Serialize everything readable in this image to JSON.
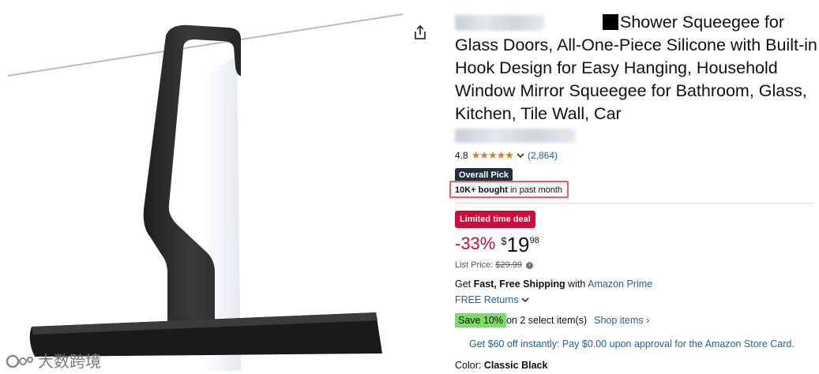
{
  "product": {
    "title": "Shower Squeegee for Glass Doors, All-One-Piece Silicone with Built-in Hook Design for Easy Hanging, Household Window Mirror Squeegee for Bathroom, Glass, Kitchen, Tile Wall, Car",
    "rating_value": "4.8",
    "stars": "★★★★★",
    "rating_count": "(2,864)",
    "badge": "Overall Pick",
    "bought_bold": "10K+ bought",
    "bought_rest": " in past month"
  },
  "pricing": {
    "deal_badge": "Limited time deal",
    "discount": "-33%",
    "currency": "$",
    "whole": "19",
    "fraction": "98",
    "list_label": "List Price: ",
    "list_value": "$29.99"
  },
  "shipping": {
    "prefix": "Get ",
    "bold": "Fast, Free Shipping",
    "middle": " with ",
    "prime_link": "Amazon Prime",
    "returns": "FREE Returns"
  },
  "promo": {
    "save": "Save 10%",
    "on_text": " on 2 select item(s)",
    "shop_link": "Shop items ›",
    "card_offer": "Get $60 off instantly: Pay $0.00 upon approval for the Amazon Store Card."
  },
  "color": {
    "label": "Color: ",
    "value": "Classic Black"
  },
  "watermark": {
    "text": "大数跨境"
  },
  "icons": {
    "share": "share-icon",
    "chevron": "chevron-down-icon",
    "info": "info-icon"
  }
}
